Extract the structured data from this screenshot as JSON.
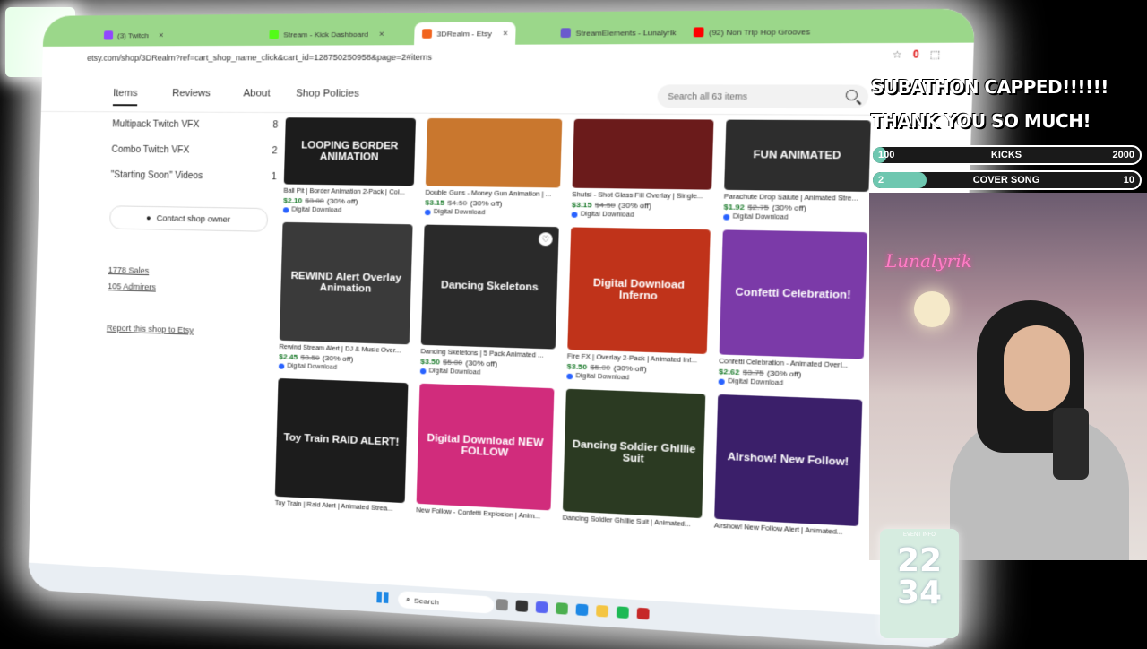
{
  "browser": {
    "tabs": [
      {
        "label": "(3) Twitch",
        "color": "#9146ff"
      },
      {
        "label": "Stream - Kick Dashboard",
        "color": "#53fc18"
      },
      {
        "label": "3DRealm - Etsy",
        "color": "#f1641e"
      },
      {
        "label": "StreamElements - Lunalyrik",
        "color": "#6a5acd"
      },
      {
        "label": "(92) Non Trip Hop Grooves",
        "color": "#ff0000"
      }
    ],
    "url": "etsy.com/shop/3DRealm?ref=cart_shop_name_click&cart_id=128750250958&page=2#items",
    "toolbar_badge": "0"
  },
  "shop": {
    "nav": [
      "Items",
      "Reviews",
      "About",
      "Shop Policies"
    ],
    "search_placeholder": "Search all 63 items",
    "categories": [
      {
        "label": "Multipack Twitch VFX",
        "count": "8"
      },
      {
        "label": "Combo Twitch VFX",
        "count": "2"
      },
      {
        "label": "\"Starting Soon\" Videos",
        "count": "1"
      }
    ],
    "contact_label": "Contact shop owner",
    "sales": "1778 Sales",
    "admirers": "105 Admirers",
    "report": "Report this shop to Etsy"
  },
  "products": [
    {
      "thumb": "LOOPING BORDER ANIMATION",
      "title": "Ball Pit | Border Animation 2-Pack | Col...",
      "sale": "$2.10",
      "orig": "$3.00",
      "off": "(30% off)",
      "dl": "Digital Download",
      "bg": "#1c1c1c"
    },
    {
      "thumb": "",
      "title": "Double Guns - Money Gun Animation | ...",
      "sale": "$3.15",
      "orig": "$4.50",
      "off": "(30% off)",
      "dl": "Digital Download",
      "bg": "#c9772e"
    },
    {
      "thumb": "",
      "title": "Shutsi - Shot Glass Fill Overlay | Single...",
      "sale": "$3.15",
      "orig": "$4.50",
      "off": "(30% off)",
      "dl": "Digital Download",
      "bg": "#6b1b1b"
    },
    {
      "thumb": "FUN ANIMATED",
      "title": "Parachute Drop Salute | Animated Stre...",
      "sale": "$1.92",
      "orig": "$2.75",
      "off": "(30% off)",
      "dl": "Digital Download",
      "bg": "#2d2d2d"
    },
    {
      "thumb": "REWIND Alert Overlay Animation",
      "title": "Rewind Stream Alert | DJ & Music Over...",
      "sale": "$2.45",
      "orig": "$3.50",
      "off": "(30% off)",
      "dl": "Digital Download",
      "bg": "#3a3a3a"
    },
    {
      "thumb": "Dancing Skeletons",
      "title": "Dancing Skeletons | 5 Pack Animated ...",
      "sale": "$3.50",
      "orig": "$5.00",
      "off": "(30% off)",
      "dl": "Digital Download",
      "bg": "#2a2a2a"
    },
    {
      "thumb": "Digital Download Inferno",
      "title": "Fire FX | Overlay 2-Pack | Animated Inf...",
      "sale": "$3.50",
      "orig": "$5.00",
      "off": "(30% off)",
      "dl": "Digital Download",
      "bg": "#c0331a"
    },
    {
      "thumb": "Confetti Celebration!",
      "title": "Confetti Celebration - Animated Overl...",
      "sale": "$2.62",
      "orig": "$3.75",
      "off": "(30% off)",
      "dl": "Digital Download",
      "bg": "#7b3aa8"
    },
    {
      "thumb": "Toy Train RAID ALERT!",
      "title": "Toy Train | Raid Alert | Animated Strea...",
      "sale": "",
      "orig": "",
      "off": "",
      "dl": "",
      "bg": "#1c1c1c"
    },
    {
      "thumb": "Digital Download NEW FOLLOW",
      "title": "New Follow - Confetti Explosion | Anim...",
      "sale": "",
      "orig": "",
      "off": "",
      "dl": "",
      "bg": "#d12c7c"
    },
    {
      "thumb": "Dancing Soldier Ghillie Suit",
      "title": "Dancing Soldier Ghillie Suit | Animated...",
      "sale": "",
      "orig": "",
      "off": "",
      "dl": "",
      "bg": "#2b3a22"
    },
    {
      "thumb": "Airshow! New Follow!",
      "title": "Airshow! New Follow Alert | Animated...",
      "sale": "",
      "orig": "",
      "off": "",
      "dl": "",
      "bg": "#3b1f6a"
    }
  ],
  "statusbar_url": "etsy.com/listing/4396201597/dancing-skeletons-5-pack-animated-loops?click_key=7168b2c4a1c4a512a6...",
  "taskbar": {
    "search": "Search"
  },
  "overlay": {
    "banner_line1": "SUBATHON CAPPED!!!!!!",
    "banner_line2": "THANK YOU SO MUCH!",
    "goals": [
      {
        "current": "100",
        "name": "KICKS",
        "target": "2000",
        "progress": 0.05
      },
      {
        "current": "2",
        "name": "COVER SONG",
        "target": "10",
        "progress": 0.2
      }
    ],
    "neon_sign": "Lunalyrik",
    "event_label": "EVENT INFO",
    "event_top": "22",
    "event_bottom": "34"
  }
}
